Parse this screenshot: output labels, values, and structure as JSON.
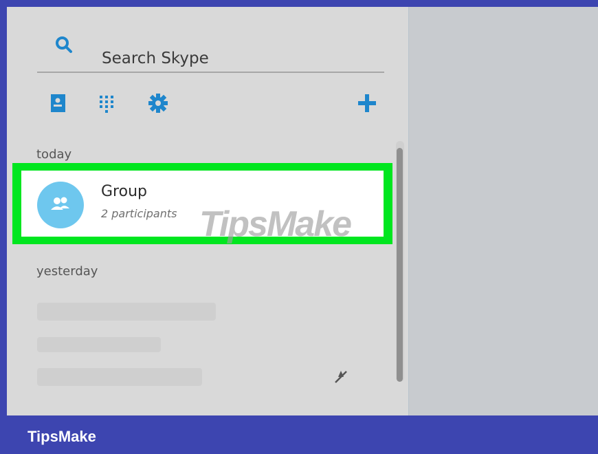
{
  "search": {
    "label": "Search Skype"
  },
  "toolbar": {
    "icons": [
      "contacts-icon",
      "dialpad-icon",
      "settings-icon",
      "add-icon"
    ]
  },
  "sections": {
    "today": "today",
    "yesterday": "yesterday"
  },
  "conversation": {
    "title": "Group",
    "subtitle": "2 participants"
  },
  "footer": {
    "brand": "TipsMake"
  },
  "watermark": {
    "text": "TipsMake"
  },
  "colors": {
    "accent": "#1e86cc",
    "highlight": "#00e61f",
    "brand_bar": "#3d45b0"
  }
}
